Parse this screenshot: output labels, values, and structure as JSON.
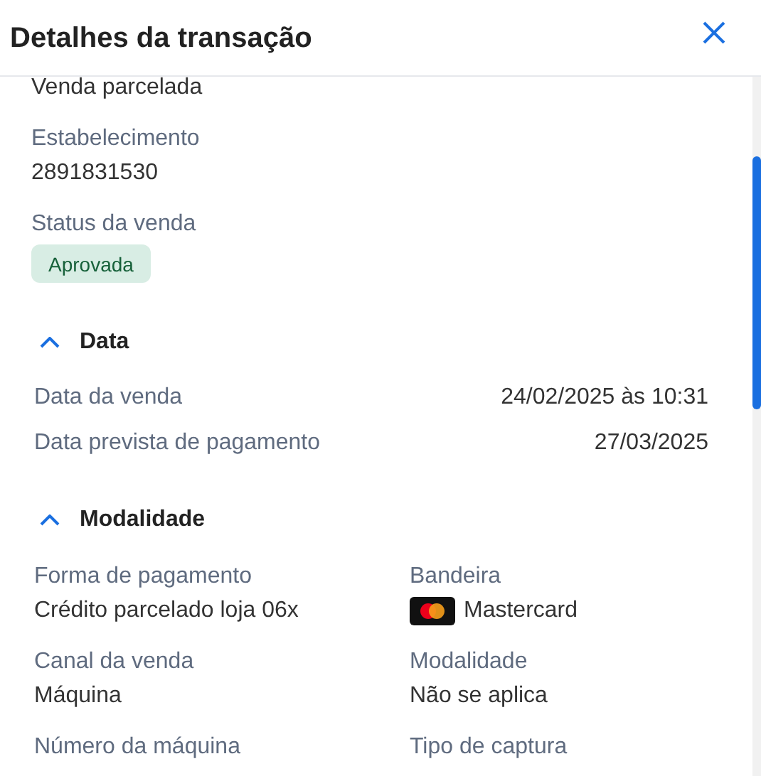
{
  "title": "Detalhes da transação",
  "summary_value": "Venda parcelada",
  "fields": [
    {
      "label": "Estabelecimento",
      "value": "2891831530"
    }
  ],
  "status": {
    "label": "Status da venda",
    "badge": "Aprovada"
  },
  "sections": [
    {
      "title": "Data",
      "expanded": true,
      "kind": "rows",
      "items": [
        {
          "label": "Data da venda",
          "value": "24/02/2025 às 10:31"
        },
        {
          "label": "Data prevista de pagamento",
          "value": "27/03/2025"
        }
      ]
    },
    {
      "title": "Modalidade",
      "expanded": true,
      "kind": "grid",
      "items": [
        {
          "label": "Forma de pagamento",
          "value": "Crédito parcelado loja 06x"
        },
        {
          "label": "Bandeira",
          "value": "Mastercard",
          "kind": "card"
        },
        {
          "label": "Canal da venda",
          "value": "Máquina"
        },
        {
          "label": "Modalidade",
          "value": "Não se aplica"
        },
        {
          "label": "Número da máquina"
        },
        {
          "label": "Tipo de captura"
        }
      ]
    }
  ]
}
